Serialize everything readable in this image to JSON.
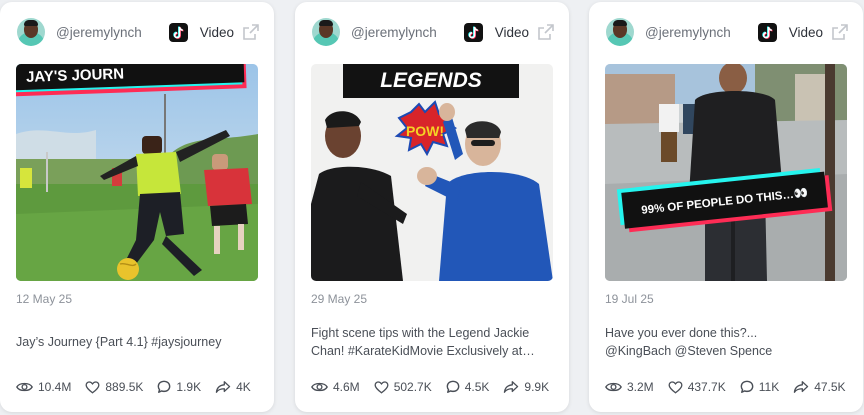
{
  "cards": [
    {
      "handle": "@jeremylynch",
      "platform_label": "Video",
      "date": "12 May 25",
      "caption": "Jay’s Journey {Part 4.1} #jaysjourney",
      "thumb_overlay": "JAY'S JOURN",
      "stats": {
        "views": "10.4M",
        "likes": "889.5K",
        "comments": "1.9K",
        "shares": "4K"
      }
    },
    {
      "handle": "@jeremylynch",
      "platform_label": "Video",
      "date": "29 May 25",
      "caption": "Fight scene tips with the Legend Jackie Chan! #KarateKidMovie Exclusively at…",
      "thumb_overlay": "LEGENDS",
      "thumb_burst": "POW!",
      "stats": {
        "views": "4.6M",
        "likes": "502.7K",
        "comments": "4.5K",
        "shares": "9.9K"
      }
    },
    {
      "handle": "@jeremylynch",
      "platform_label": "Video",
      "date": "19 Jul 25",
      "caption": "Have you ever done this?... @KingBach @Steven Spence",
      "thumb_overlay": "99% OF PEOPLE DO THIS…👀",
      "stats": {
        "views": "3.2M",
        "likes": "437.7K",
        "comments": "11K",
        "shares": "47.5K"
      }
    }
  ],
  "colors": {
    "tiktok_cyan": "#25f4ee",
    "tiktok_pink": "#fe2c55",
    "card_bg": "#ffffff",
    "page_bg": "#eef0f3"
  },
  "icons": [
    "tiktok-icon",
    "external-link-icon",
    "eye-icon",
    "heart-icon",
    "comment-icon",
    "share-icon"
  ]
}
